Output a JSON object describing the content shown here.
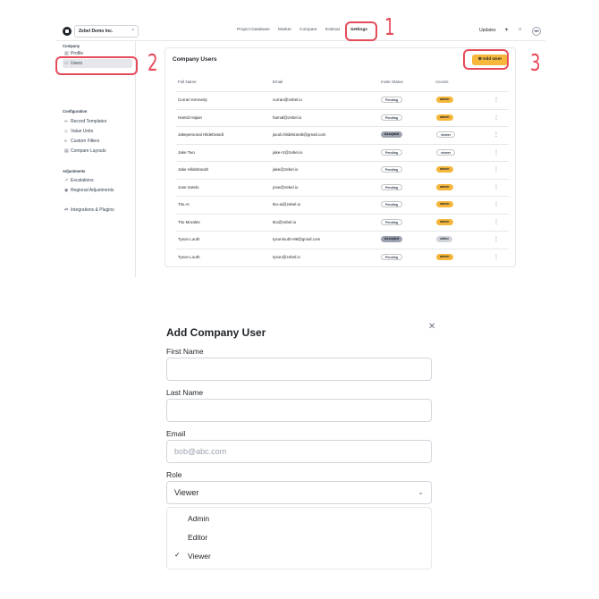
{
  "header": {
    "org_name": "Zebel Demo Inc.",
    "nav": [
      "Project Database",
      "Market",
      "Compare",
      "Estimat",
      "Settings"
    ],
    "updates": "Updates",
    "avatar_initials": "HH"
  },
  "sidebar": {
    "company_heading": "Company",
    "company_items": [
      {
        "label": "Profile",
        "icon": "building-icon"
      },
      {
        "label": "Users",
        "icon": "users-icon"
      }
    ],
    "configuration_heading": "Configuration",
    "configuration_items": [
      {
        "label": "Record Templates",
        "icon": "link-icon"
      },
      {
        "label": "Value Units",
        "icon": "tag-icon"
      },
      {
        "label": "Custom Filters",
        "icon": "list-icon"
      },
      {
        "label": "Compare Layouts",
        "icon": "layout-icon"
      }
    ],
    "adjustments_heading": "Adjustments",
    "adjustments_items": [
      {
        "label": "Escalations",
        "icon": "trend-icon"
      },
      {
        "label": "Regional Adjustments",
        "icon": "pin-icon"
      }
    ],
    "integrations": {
      "label": "Integrations & Plugins",
      "icon": "swap-icon"
    }
  },
  "users_panel": {
    "title": "Company Users",
    "add_button": "Add User",
    "columns": [
      "Full Name",
      "Email",
      "Invite Status",
      "Access"
    ],
    "rows": [
      {
        "name": "Curran Kennedy",
        "email": "curran@zebel.io",
        "status": "Pending",
        "access": "admin"
      },
      {
        "name": "Hamid Hajian",
        "email": "hamid@zebel.io",
        "status": "Pending",
        "access": "admin"
      },
      {
        "name": "Jakepersonal Hildebrandt",
        "email": "jacob.hildebrandt@gmail.com",
        "status": "Accepted",
        "access": "viewer"
      },
      {
        "name": "Jake Two",
        "email": "jake+2@zebel.io",
        "status": "Pending",
        "access": "viewer"
      },
      {
        "name": "Jake Hildebrandt",
        "email": "jake@zebel.io",
        "status": "Pending",
        "access": "admin"
      },
      {
        "name": "Jose Sotelo",
        "email": "jose@zebel.io",
        "status": "Pending",
        "access": "admin"
      },
      {
        "name": "Tito AI",
        "email": "tito-ai@zebel.io",
        "status": "Pending",
        "access": "admin"
      },
      {
        "name": "Tito Morales",
        "email": "tito@zebel.io",
        "status": "Pending",
        "access": "admin"
      },
      {
        "name": "Tyson Louth",
        "email": "tysonlouth+99@gmail.com",
        "status": "Accepted",
        "access": "editor"
      },
      {
        "name": "Tyson Louth",
        "email": "tyson@zebel.io",
        "status": "Pending",
        "access": "admin"
      }
    ]
  },
  "annotations": [
    "1",
    "2",
    "3"
  ],
  "modal": {
    "title": "Add Company User",
    "first_name_label": "First Name",
    "last_name_label": "Last Name",
    "email_label": "Email",
    "email_placeholder": "bob@abc.com",
    "role_label": "Role",
    "role_value": "Viewer",
    "role_options": [
      "Admin",
      "Editor",
      "Viewer"
    ]
  },
  "colors": {
    "accent": "#f5b73c",
    "annotation": "#e64b5a"
  }
}
